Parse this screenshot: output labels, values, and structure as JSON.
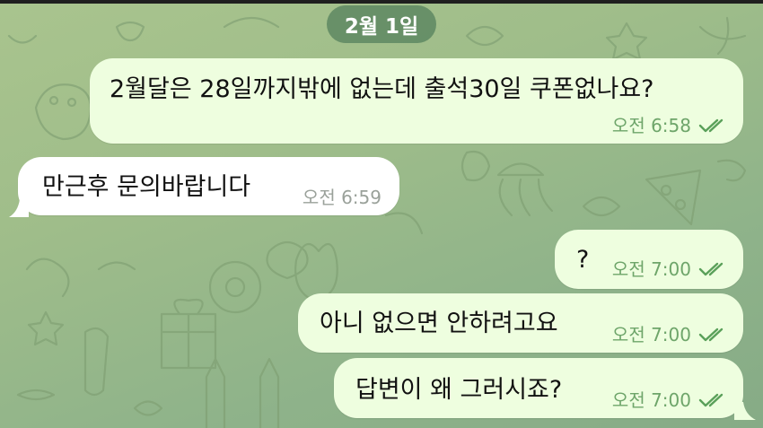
{
  "date_separator": "2월 1일",
  "colors": {
    "outgoing_bubble": "#eefedf",
    "incoming_bubble": "#ffffff",
    "check_marks": "#5aa05a",
    "date_chip": "#54805c"
  },
  "messages": [
    {
      "direction": "outgoing",
      "text": "2월달은 28일까지밖에 없는데 출석30일 쿠폰없나요?",
      "time": "오전 6:58",
      "read": true
    },
    {
      "direction": "incoming",
      "text": "만근후 문의바랍니다",
      "time": "오전 6:59"
    },
    {
      "direction": "outgoing",
      "text": "?",
      "time": "오전 7:00",
      "read": true
    },
    {
      "direction": "outgoing",
      "text": "아니 없으면 안하려고요",
      "time": "오전 7:00",
      "read": true
    },
    {
      "direction": "outgoing",
      "text": "답변이 왜 그러시죠?",
      "time": "오전 7:00",
      "read": true
    }
  ]
}
